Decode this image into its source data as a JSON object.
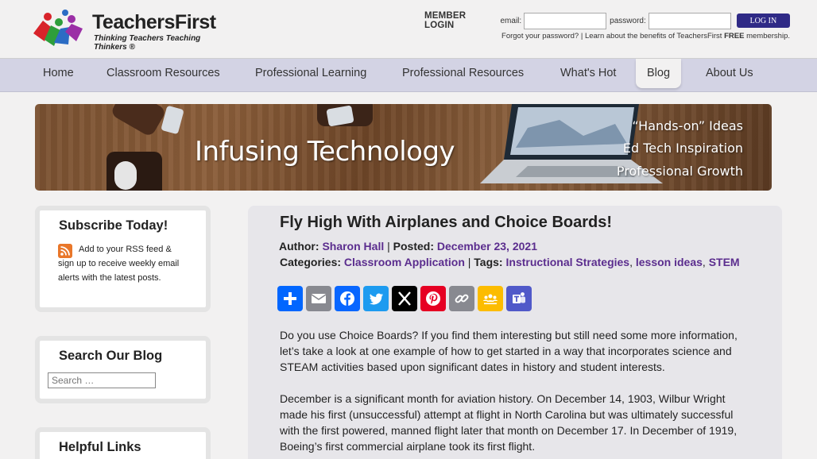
{
  "brand": {
    "name": "TeachersFirst",
    "tagline": "Thinking Teachers Teaching Thinkers ®"
  },
  "login": {
    "title": "MEMBER LOGIN",
    "email_label": "email:",
    "password_label": "password:",
    "button": "LOG IN",
    "forgot": "Forgot your password?",
    "separator": "|",
    "benefits_pre": "Learn about the benefits of TeachersFirst",
    "benefits_free": "FREE",
    "benefits_post": "membership."
  },
  "nav": {
    "items": [
      "Home",
      "Classroom Resources",
      "Professional Learning",
      "Professional Resources",
      "What's Hot",
      "Blog",
      "About Us"
    ],
    "active": "Blog"
  },
  "banner": {
    "title": "Infusing Technology",
    "lines": [
      "“Hands-on” Ideas",
      "Ed Tech Inspiration",
      "Professional Growth"
    ]
  },
  "sidebar": {
    "subscribe": {
      "title": "Subscribe Today!",
      "text": "Add to your RSS feed & sign up to receive weekly email alerts with the latest posts."
    },
    "search": {
      "title": "Search Our Blog",
      "placeholder": "Search …"
    },
    "links": {
      "title": "Helpful Links"
    }
  },
  "post": {
    "title": "Fly High With Airplanes and Choice Boards!",
    "author_label": "Author:",
    "author": "Sharon Hall",
    "posted_label": "Posted:",
    "date": "December 23, 2021",
    "categories_label": "Categories:",
    "category": "Classroom Application",
    "tags_label": "Tags:",
    "tags": [
      "Instructional Strategies",
      "lesson ideas",
      "STEM"
    ],
    "share": [
      {
        "name": "Share",
        "color": "#0166ff",
        "icon": "share-plus-icon"
      },
      {
        "name": "Email",
        "color": "#888990",
        "icon": "email-icon"
      },
      {
        "name": "Facebook",
        "color": "#0866ff",
        "icon": "facebook-icon"
      },
      {
        "name": "Twitter",
        "color": "#1d9bf0",
        "icon": "twitter-icon"
      },
      {
        "name": "X",
        "color": "#000000",
        "icon": "x-icon"
      },
      {
        "name": "Pinterest",
        "color": "#e60023",
        "icon": "pinterest-icon"
      },
      {
        "name": "Copy Link",
        "color": "#888990",
        "icon": "copy-link-icon"
      },
      {
        "name": "Google Classroom",
        "color": "#fcbc00",
        "icon": "google-classroom-icon"
      },
      {
        "name": "Microsoft Teams",
        "color": "#5059c9",
        "icon": "teams-icon"
      }
    ],
    "paragraphs": [
      "Do you use Choice Boards? If you find them interesting but still need some more information, let’s take a look at one example of how to get started in a way that incorporates science and STEAM activities based upon significant dates in history and student interests.",
      "December is a significant month for aviation history. On December 14, 1903, Wilbur Wright made his first (unsuccessful) attempt at flight in North Carolina but was ultimately successful with the first powered, manned flight later that month on December 17. In December of 1919, Boeing’s first commercial airplane took its first flight."
    ]
  }
}
